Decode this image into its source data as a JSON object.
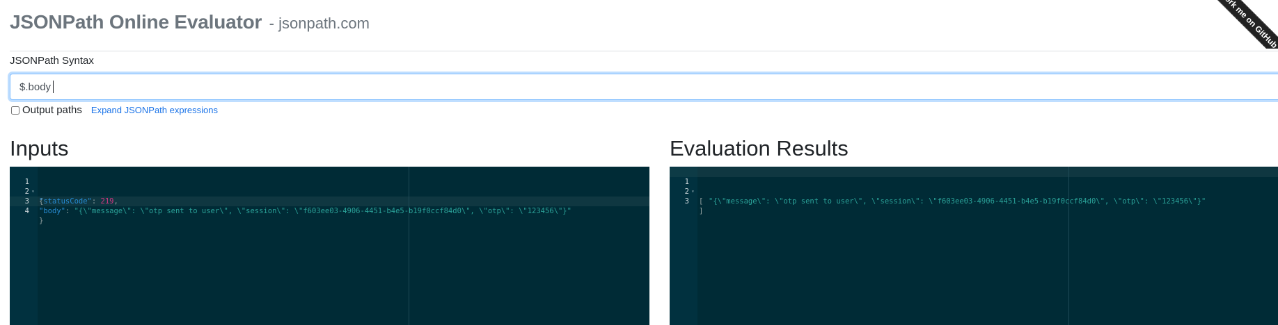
{
  "header": {
    "title": "JSONPath Online Evaluator",
    "subtitle": "- jsonpath.com"
  },
  "query": {
    "label": "JSONPath Syntax",
    "value": "$.body"
  },
  "options": {
    "output_paths_label": "Output paths",
    "output_paths_checked": false,
    "expand_link": "Expand JSONPath expressions"
  },
  "inputs": {
    "heading": "Inputs",
    "line_numbers": [
      "1",
      "2",
      "3",
      "4"
    ],
    "lines": {
      "l1": "{",
      "l2_key": "\"statusCode\"",
      "l2_colon": ": ",
      "l2_value": "219",
      "l2_comma": ",",
      "l3_key": "\"body\"",
      "l3_colon": ": ",
      "l3_value": "\"{\\\"message\\\": \\\"otp sent to user\\\", \\\"session\\\": \\\"f603ee03-4906-4451-b4e5-b19f0ccf84d0\\\", \\\"otp\\\": \\\"123456\\\"}\"",
      "l4": "}"
    }
  },
  "results": {
    "heading": "Evaluation Results",
    "line_numbers": [
      "1",
      "2",
      "3"
    ],
    "lines": {
      "l1": "[",
      "l2_value": "\"{\\\"message\\\": \\\"otp sent to user\\\", \\\"session\\\": \\\"f603ee03-4906-4451-b4e5-b19f0ccf84d0\\\", \\\"otp\\\": \\\"123456\\\"}\"",
      "l3": "]"
    }
  },
  "ribbon": {
    "label": "Fork me on GitHub"
  },
  "colors": {
    "editor_background": "#002b36",
    "key": "#268bd2",
    "string": "#2aa198",
    "number": "#d33682",
    "link": "#1a73e8"
  }
}
